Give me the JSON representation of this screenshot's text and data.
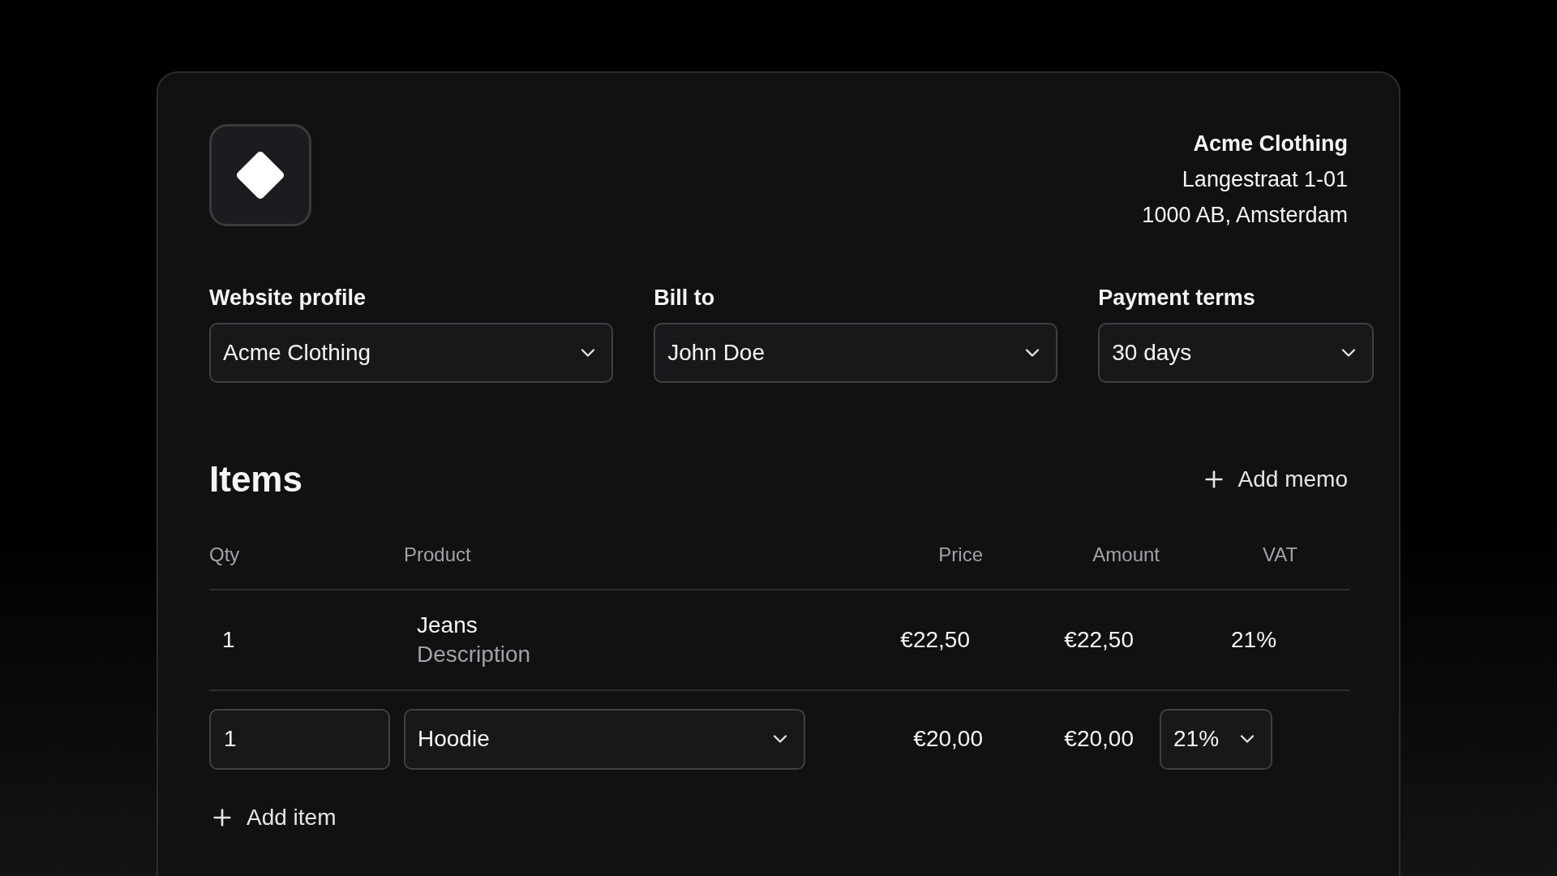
{
  "company": {
    "name": "Acme Clothing",
    "address_lines": [
      "Langestraat 1-01",
      "1000 AB, Amsterdam"
    ]
  },
  "fields": [
    {
      "label": "Website profile",
      "value": "Acme Clothing"
    },
    {
      "label": "Bill to",
      "value": "John Doe"
    },
    {
      "label": "Payment terms",
      "value": "30 days"
    }
  ],
  "items": {
    "title": "Items",
    "add_memo": "Add memo",
    "columns": [
      "Qty",
      "Product",
      "Price",
      "Amount",
      "VAT"
    ],
    "rows": [
      {
        "kind": "static",
        "qty": "1",
        "product": "Jeans",
        "description": "Description",
        "price": "€22,50",
        "amount": "€22,50",
        "vat": "21%"
      },
      {
        "kind": "edit",
        "qty": "1",
        "product": "Hoodie",
        "price": "€20,00",
        "amount": "€20,00",
        "vat": "21%"
      }
    ],
    "add_item": "Add item"
  }
}
